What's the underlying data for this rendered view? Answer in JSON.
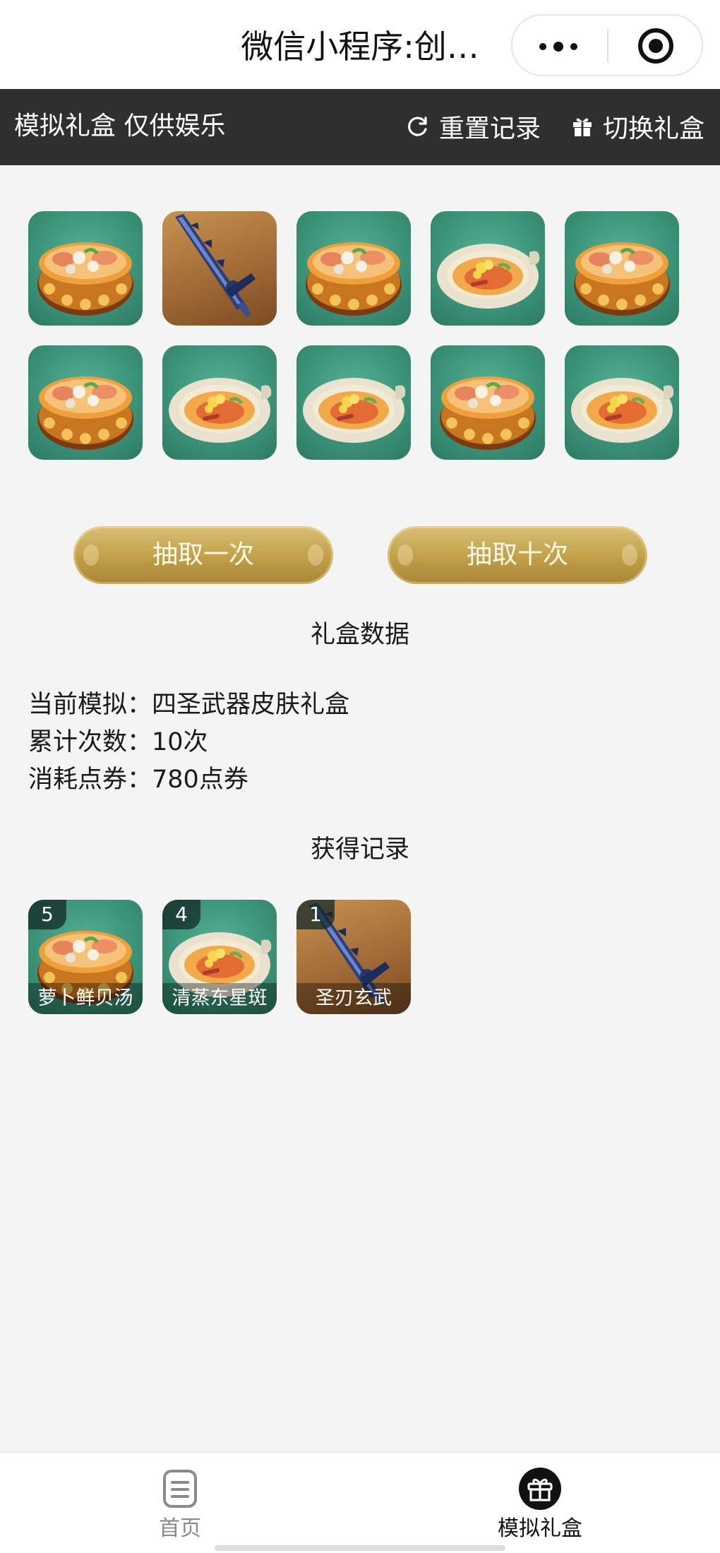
{
  "titlebar": {
    "title": "微信小程序:创…",
    "menu_icon": "more-dots-icon",
    "close_icon": "target-circle-icon"
  },
  "toolbar": {
    "title": "模拟礼盒 仅供娱乐",
    "reset_label": "重置记录",
    "reset_icon": "refresh-icon",
    "switch_label": "切换礼盒",
    "switch_icon": "gift-icon"
  },
  "results": [
    {
      "item": "萝卜鲜贝汤",
      "art": "soup-bowl"
    },
    {
      "item": "圣刃玄武",
      "art": "sword"
    },
    {
      "item": "萝卜鲜贝汤",
      "art": "soup-bowl"
    },
    {
      "item": "清蒸东星斑",
      "art": "steamed-dish"
    },
    {
      "item": "萝卜鲜贝汤",
      "art": "soup-bowl"
    },
    {
      "item": "萝卜鲜贝汤",
      "art": "soup-bowl"
    },
    {
      "item": "清蒸东星斑",
      "art": "steamed-dish"
    },
    {
      "item": "清蒸东星斑",
      "art": "steamed-dish"
    },
    {
      "item": "萝卜鲜贝汤",
      "art": "soup-bowl"
    },
    {
      "item": "清蒸东星斑",
      "art": "steamed-dish"
    }
  ],
  "buttons": {
    "draw_once": "抽取一次",
    "draw_ten": "抽取十次"
  },
  "stats": {
    "title": "礼盒数据",
    "current_label": "当前模拟：",
    "current_value": "四圣武器皮肤礼盒",
    "count_label": "累计次数：",
    "count_value": "10次",
    "cost_label": "消耗点券：",
    "cost_value": "780点券"
  },
  "records": {
    "title": "获得记录",
    "items": [
      {
        "count": "5",
        "name": "萝卜鲜贝汤",
        "art": "soup-bowl"
      },
      {
        "count": "4",
        "name": "清蒸东星斑",
        "art": "steamed-dish"
      },
      {
        "count": "1",
        "name": "圣刃玄武",
        "art": "sword"
      }
    ]
  },
  "tabbar": {
    "home_label": "首页",
    "home_icon": "document-icon",
    "giftbox_label": "模拟礼盒",
    "giftbox_icon": "gift-circle-icon",
    "active": "模拟礼盒"
  },
  "colors": {
    "toolbar_bg": "#2f2f2f",
    "page_bg": "#f4f4f4",
    "tile_green": "#3c9478",
    "tile_brown": "#a26a36",
    "button_gold": "#c3a24a"
  }
}
